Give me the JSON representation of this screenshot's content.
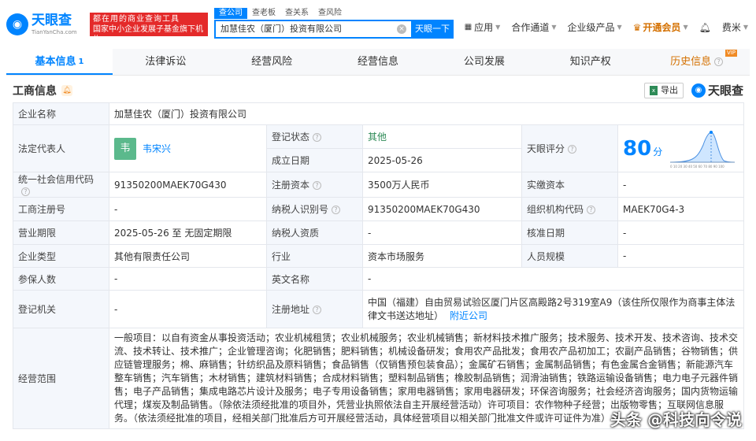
{
  "header": {
    "logo_text": "天眼查",
    "logo_sub": "TianYanCha.com",
    "slogan_line1": "都在用的商业查询工具",
    "slogan_line2": "国家中小企业发展子基金旗下机构",
    "search_tabs": [
      "查公司",
      "查老板",
      "查关系",
      "查风险"
    ],
    "search_value": "加慧佳农（厦门）投资有限公司",
    "search_button": "天眼一下",
    "nav": [
      "应用",
      "合作通道",
      "企业级产品",
      "开通会员",
      "费米"
    ]
  },
  "tabs": [
    {
      "label": "基本信息",
      "count": "1"
    },
    {
      "label": "法律诉讼"
    },
    {
      "label": "经营风险"
    },
    {
      "label": "经营信息"
    },
    {
      "label": "公司发展"
    },
    {
      "label": "知识产权"
    },
    {
      "label": "历史信息",
      "badge": "VIP"
    }
  ],
  "section": {
    "title": "工商信息",
    "export": "导出",
    "watermark": "天眼查"
  },
  "info": {
    "company_name_label": "企业名称",
    "company_name": "加慧佳农（厦门）投资有限公司",
    "legal_rep_label": "法定代表人",
    "legal_rep_avatar": "韦",
    "legal_rep": "韦宋兴",
    "reg_status_label": "登记状态",
    "reg_status": "其他",
    "found_date_label": "成立日期",
    "found_date": "2025-05-26",
    "score_label": "天眼评分",
    "score": "80",
    "score_unit": "分",
    "credit_code_label": "统一社会信用代码",
    "credit_code": "91350200MAEK70G430",
    "reg_capital_label": "注册资本",
    "reg_capital": "3500万人民币",
    "paid_capital_label": "实缴资本",
    "paid_capital": "-",
    "reg_no_label": "工商注册号",
    "reg_no": "-",
    "tax_id_label": "纳税人识别号",
    "tax_id": "91350200MAEK70G430",
    "org_code_label": "组织机构代码",
    "org_code": "MAEK70G4-3",
    "term_label": "营业期限",
    "term": "2025-05-26 至 无固定期限",
    "tax_quality_label": "纳税人资质",
    "tax_quality": "-",
    "approve_date_label": "核准日期",
    "approve_date": "-",
    "type_label": "企业类型",
    "type": "其他有限责任公司",
    "industry_label": "行业",
    "industry": "资本市场服务",
    "staff_label": "人员规模",
    "staff": "-",
    "insured_label": "参保人数",
    "insured": "-",
    "en_name_label": "英文名称",
    "en_name": "-",
    "reg_org_label": "登记机关",
    "reg_org": "-",
    "address_label": "注册地址",
    "address": "中国（福建）自由贸易试验区厦门片区高殿路2号319室A9（该住所仅限作为商事主体法律文书送达地址）",
    "address_link": "附近公司",
    "scope_label": "经营范围",
    "scope": "一般项目：以自有资金从事投资活动；农业机械租赁；农业机械服务；农业机械销售；新材料技术推广服务；技术服务、技术开发、技术咨询、技术交流、技术转让、技术推广；企业管理咨询；化肥销售；肥料销售；机械设备研发；食用农产品批发；食用农产品初加工；农副产品销售；谷物销售；供应链管理服务；棉、麻销售；针纺织品及原料销售；食品销售（仅销售预包装食品）；金属矿石销售；金属制品销售；有色金属合金销售；新能源汽车整车销售；汽车销售；木材销售；建筑材料销售；合成材料销售；塑料制品销售；橡胶制品销售；润滑油销售；铁路运输设备销售；电力电子元器件销售；电子产品销售；集成电路芯片设计及服务；电子专用设备销售；家用电器销售；家用电器研发；环保咨询服务；社会经济咨询服务；国内货物运输代理；煤炭及制品销售。（除依法须经批准的项目外，凭营业执照依法自主开展经营活动）许可项目：农作物种子经营；出版物零售；互联网信息服务。（依法须经批准的项目，经相关部门批准后方可开展经营活动，具体经营项目以相关部门批准文件或许可证件为准）"
  },
  "footer_watermark": "头条 @科技向令说"
}
